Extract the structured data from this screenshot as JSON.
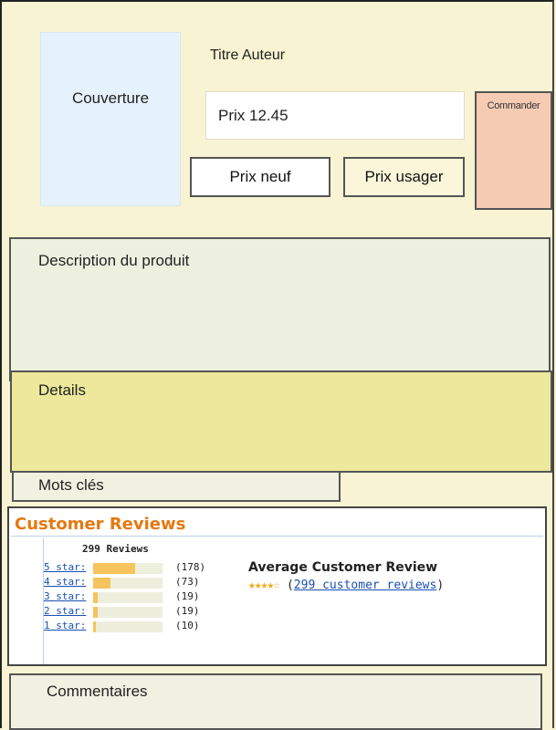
{
  "product": {
    "cover_label": "Couverture",
    "title_author": "Titre Auteur",
    "price_label": "Prix 12.45",
    "new_price_button": "Prix neuf",
    "used_price_button": "Prix usager",
    "order_button": "Commander"
  },
  "sections": {
    "description": "Description du produit",
    "details": "Details",
    "keywords": "Mots clés",
    "comments": "Commentaires"
  },
  "reviews": {
    "title": "Customer Reviews",
    "count_label": "299 Reviews",
    "rows": [
      {
        "label": "5 star:",
        "count": "(178)",
        "fraction": 0.6
      },
      {
        "label": "4 star:",
        "count": "(73)",
        "fraction": 0.25
      },
      {
        "label": "3 star:",
        "count": "(19)",
        "fraction": 0.06
      },
      {
        "label": "2 star:",
        "count": "(19)",
        "fraction": 0.06
      },
      {
        "label": "1 star:",
        "count": "(10)",
        "fraction": 0.04
      }
    ],
    "average_title": "Average Customer Review",
    "average_stars": "★★★★☆",
    "average_open": "(",
    "average_link": "299 customer reviews",
    "average_close": ")"
  },
  "colors": {
    "page_bg": "#f8f3d2",
    "cover_bg": "#e6f2fb",
    "order_bg": "#f6cbb3",
    "details_bg": "#ede89b",
    "reviews_title": "#e47911",
    "bar_fill": "#f7c35d",
    "link": "#1a4fb2"
  }
}
